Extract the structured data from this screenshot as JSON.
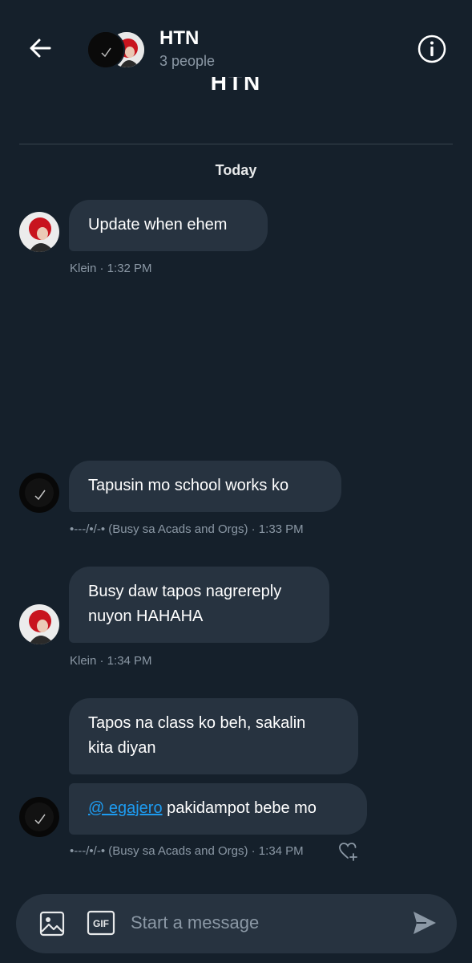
{
  "header": {
    "title": "HTN",
    "subtitle": "3 people",
    "scrolled_title": "HTN"
  },
  "date_separator": "Today",
  "messages": [
    {
      "text": "Update when ehem",
      "meta": "Klein · 1:32 PM"
    },
    {
      "text": "Tapusin mo school works ko",
      "meta": "•---/•/-• (Busy sa Acads and Orgs) · 1:33 PM"
    },
    {
      "text_line1": "Busy daw tapos nagrereply",
      "text_line2": "nuyon HAHAHA",
      "meta": "Klein · 1:34 PM"
    },
    {
      "text_line1": "Tapos na class ko beh, sakalin",
      "text_line2": "kita diyan"
    },
    {
      "mention": "@ egajero",
      "text": " pakidampot bebe mo",
      "meta": "•---/•/-• (Busy sa Acads and Orgs) · 1:34 PM"
    }
  ],
  "composer": {
    "placeholder": "Start a message",
    "gif_label": "GIF"
  },
  "icons": {
    "back": "arrow-left-icon",
    "info": "info-icon",
    "image": "image-icon",
    "gif": "gif-icon",
    "send": "send-icon",
    "react": "heart-plus-icon"
  },
  "colors": {
    "background": "#15202b",
    "bubble": "#273340",
    "accent": "#1d9bf0",
    "muted": "#8b98a5"
  }
}
